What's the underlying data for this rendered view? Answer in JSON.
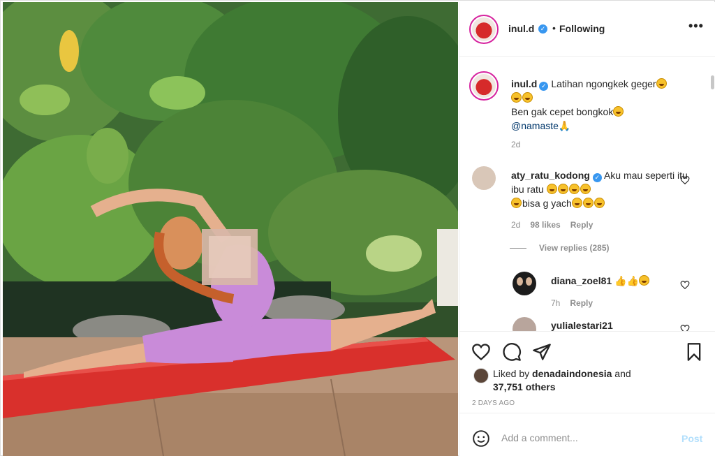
{
  "header": {
    "username": "inul.d",
    "separator": "•",
    "follow_status": "Following",
    "more_icon": "more-horizontal-icon"
  },
  "caption": {
    "username": "inul.d",
    "line1": "Latihan ngongkek geger",
    "line3": "Ben gak cepet bongkok",
    "mention": "@namaste",
    "time": "2d"
  },
  "comments": [
    {
      "username": "aty_ratu_kodong",
      "text_a": "Aku mau seperti itu ibu ratu",
      "text_b": "bisa g yach",
      "time": "2d",
      "likes": "98 likes",
      "reply": "Reply",
      "view_replies": "View replies (285)"
    },
    {
      "username": "diana_zoel81",
      "time": "7h",
      "reply": "Reply"
    },
    {
      "username": "yulialestari21"
    }
  ],
  "actions": {
    "like_icon": "heart-icon",
    "comment_icon": "comment-icon",
    "share_icon": "share-icon",
    "save_icon": "bookmark-icon"
  },
  "likes": {
    "prefix": "Liked by",
    "user": "denadaindonesia",
    "and": "and",
    "count": "37,751 others"
  },
  "post_date": "2 DAYS AGO",
  "add_comment": {
    "placeholder": "Add a comment...",
    "post_label": "Post"
  },
  "colors": {
    "accent": "#3897f0",
    "link": "#00376b",
    "muted": "#8e8e8e",
    "post_disabled": "#b2dffc",
    "mat": "#d9302c",
    "outfit": "#c98bd9"
  }
}
